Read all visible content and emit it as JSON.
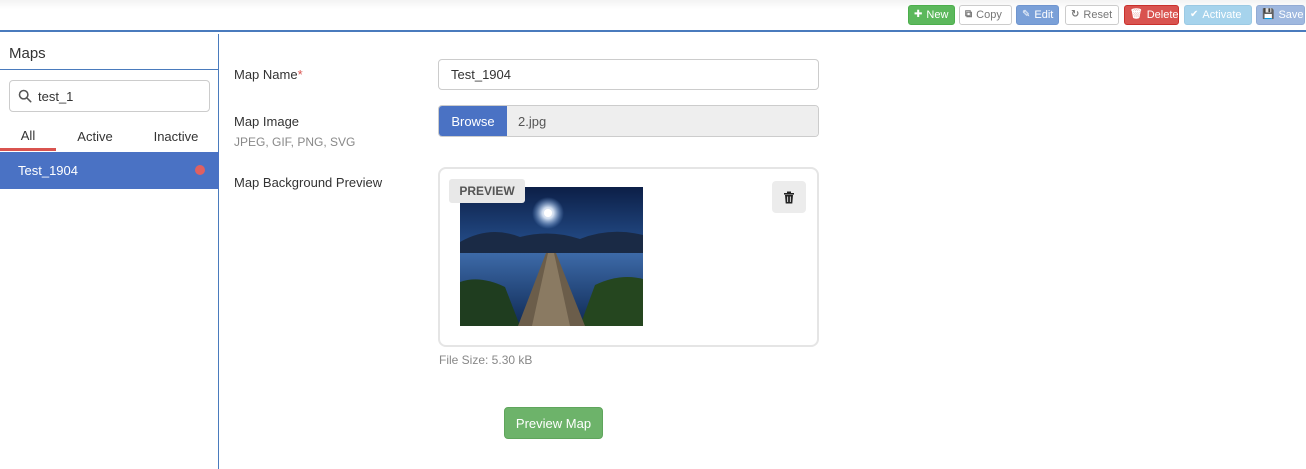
{
  "toolbar": {
    "new": "New",
    "copy": "Copy",
    "edit": "Edit",
    "reset": "Reset",
    "delete": "Delete",
    "activate": "Activate",
    "save": "Save"
  },
  "sidebar": {
    "title": "Maps",
    "search_value": "test_1",
    "tabs": [
      "All",
      "Active",
      "Inactive"
    ],
    "selected_tab": "All",
    "items": [
      {
        "label": "Test_1904",
        "status_color": "#e06060"
      }
    ]
  },
  "form": {
    "map_name_label": "Map Name",
    "required_mark": "*",
    "map_name_value": "Test_1904",
    "map_image_label": "Map Image",
    "map_image_hint": "JPEG, GIF, PNG, SVG",
    "browse_label": "Browse",
    "file_name": "2.jpg",
    "bg_preview_label": "Map Background Preview",
    "preview_tag": "PREVIEW",
    "file_size": "File Size: 5.30 kB",
    "preview_map_button": "Preview Map"
  },
  "colors": {
    "accent_blue": "#4a72c4",
    "success_green": "#5cb85c",
    "danger_red": "#d9534f"
  },
  "icons": {
    "new": "plus-icon",
    "copy": "copy-icon",
    "edit": "pencil-icon",
    "reset": "refresh-icon",
    "delete": "trash-icon",
    "activate": "check-icon",
    "save": "floppy-icon",
    "search": "search-icon",
    "remove_image": "trash-icon"
  }
}
